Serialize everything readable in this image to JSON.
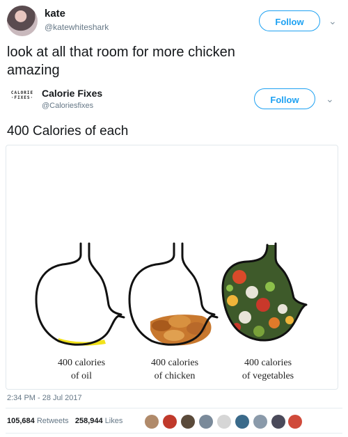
{
  "tweet": {
    "name": "kate",
    "handle": "@katewhiteshark",
    "follow_label": "Follow",
    "text_line1": "look at all that room for more chicken",
    "text_line2": "amazing",
    "timestamp": "2:34 PM - 28 Jul 2017",
    "retweets_count": "105,684",
    "retweets_label": "Retweets",
    "likes_count": "258,944",
    "likes_label": "Likes"
  },
  "quoted": {
    "logo_line1": "CALORIE",
    "logo_line2": "·FIXES·",
    "name": "Calorie Fixes",
    "handle": "@Caloriesfixes",
    "follow_label": "Follow",
    "text": "400 Calories of each"
  },
  "image": {
    "labels": [
      {
        "line1": "400 calories",
        "line2": "of oil"
      },
      {
        "line1": "400 calories",
        "line2": "of chicken"
      },
      {
        "line1": "400 calories",
        "line2": "of vegetables"
      }
    ]
  },
  "colors": {
    "accent": "#1da1f2",
    "oil": "#f2e21a",
    "chicken": "#c8782e"
  },
  "icons": {
    "chevron": "chevron-down-icon"
  }
}
